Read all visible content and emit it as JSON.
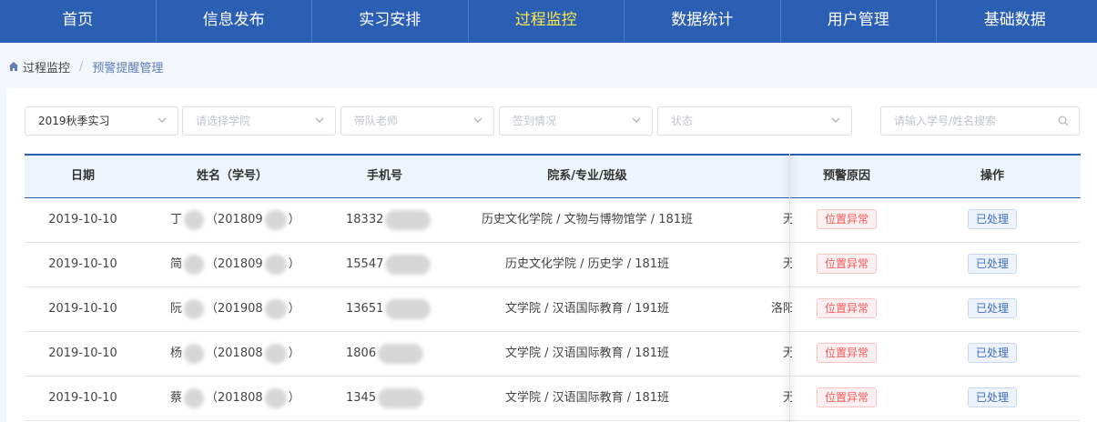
{
  "nav": {
    "items": [
      "首页",
      "信息发布",
      "实习安排",
      "过程监控",
      "数据统计",
      "用户管理",
      "基础数据"
    ],
    "active": "过程监控"
  },
  "breadcrumb": {
    "parent": "过程监控",
    "separator": "/",
    "current": "预警提醒管理"
  },
  "filters": {
    "term": "2019秋季实习",
    "college_placeholder": "请选择学院",
    "teacher_placeholder": "带队老师",
    "checkin_placeholder": "签到情况",
    "status_placeholder": "状态",
    "search_placeholder": "请输入学号/姓名搜索"
  },
  "table": {
    "headers": [
      "日期",
      "姓名（学号）",
      "手机号",
      "院系/专业/班级",
      "",
      "预警原因",
      "操作"
    ],
    "rows": [
      {
        "date": "2019-10-10",
        "name": "丁",
        "id": "（201809",
        "id_end": "）",
        "phone": "18332",
        "dept": "历史文化学院 / 文物与博物馆学 / 181班",
        "loc": "无",
        "reason": "位置异常",
        "action": "已处理"
      },
      {
        "date": "2019-10-10",
        "name": "简",
        "id": "（201809",
        "id_end": "）",
        "phone": "15547",
        "dept": "历史文化学院 / 历史学 / 181班",
        "loc": "无",
        "reason": "位置异常",
        "action": "已处理"
      },
      {
        "date": "2019-10-10",
        "name": "阮",
        "id": "（201908",
        "id_end": "）",
        "phone": "13651",
        "dept": "文学院 / 汉语国际教育 / 191班",
        "loc": "洛阳",
        "reason": "位置异常",
        "action": "已处理"
      },
      {
        "date": "2019-10-10",
        "name": "杨",
        "id": "（201808",
        "id_end": "）",
        "phone": "1806",
        "dept": "文学院 / 汉语国际教育 / 181班",
        "loc": "无",
        "reason": "位置异常",
        "action": "已处理"
      },
      {
        "date": "2019-10-10",
        "name": "蔡",
        "id": "（201808",
        "id_end": "）",
        "phone": "1345",
        "dept": "文学院 / 汉语国际教育 / 181班",
        "loc": "无",
        "reason": "位置异常",
        "action": "已处理"
      }
    ]
  },
  "icons": {
    "home": "home-icon",
    "dropdown": "chevron-down-icon",
    "search": "search-icon"
  },
  "colors": {
    "nav_bg": "#2b5fb4",
    "nav_active": "#f9e94a",
    "warn": "#f25a5a",
    "ok": "#3b6fc4"
  }
}
